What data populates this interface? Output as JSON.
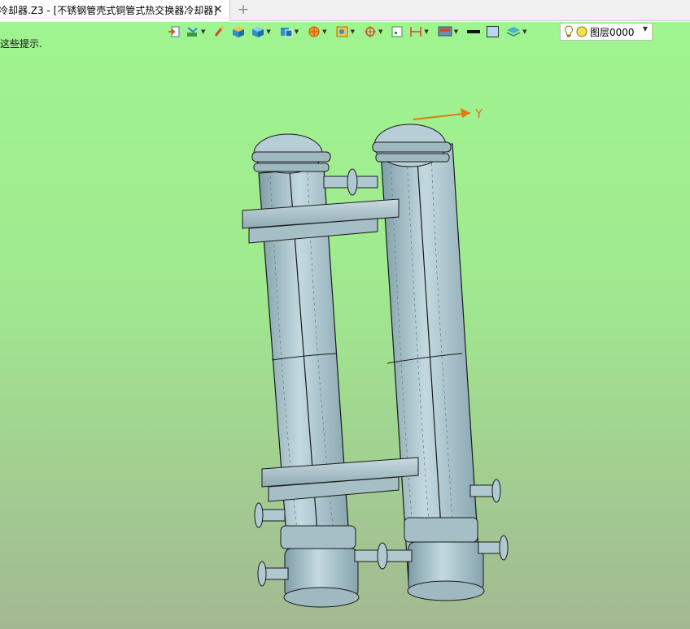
{
  "tab": {
    "title": "冷却器.Z3 - [不锈钢管壳式铜管式热交换器冷却器]",
    "close_glyph": "✕",
    "add_glyph": "+"
  },
  "hint_text": "这些提示.",
  "toolbar": {
    "layer_name": "图层0000",
    "icons": [
      "exit-icon",
      "layers-paint-icon",
      "brush-icon",
      "shaded-box-icon",
      "solid-box-icon",
      "box-view-icon",
      "sphere-render-icon",
      "image-icon",
      "target-icon",
      "frame-icon",
      "dimension-icon",
      "screen-icon",
      "line-color-swatch",
      "fill-color-swatch",
      "stack-icon",
      "light-bulb-icon",
      "layer-color-icon"
    ],
    "colors": {
      "line_swatch": "#111111",
      "fill_swatch": "#b8d8f0",
      "bulb": "#f2e14b"
    }
  },
  "axis": {
    "label": "Y",
    "color": "#e07a10"
  },
  "colors": {
    "viewport_top": "#9ff58f",
    "viewport_bottom": "#a3b892",
    "steel": "#a7c3cd",
    "steel_dark": "#7f9ea8",
    "outline": "#1a1a1a"
  }
}
